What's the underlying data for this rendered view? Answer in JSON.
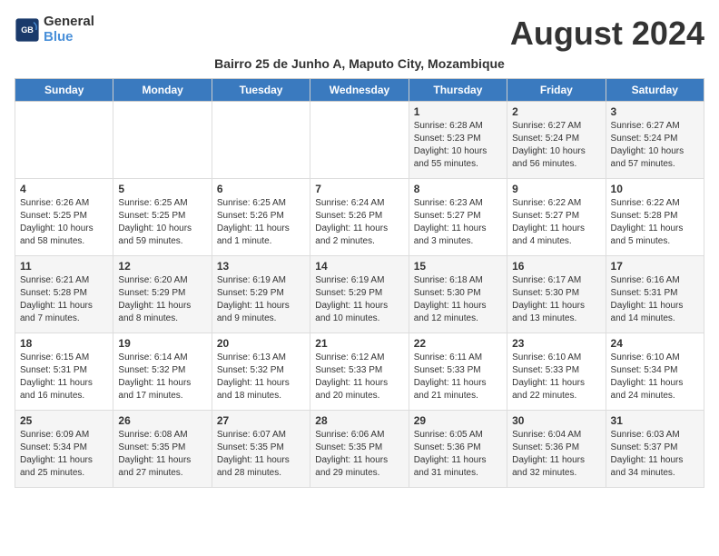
{
  "header": {
    "logo_general": "General",
    "logo_blue": "Blue",
    "month_title": "August 2024",
    "subtitle": "Bairro 25 de Junho A, Maputo City, Mozambique"
  },
  "days_of_week": [
    "Sunday",
    "Monday",
    "Tuesday",
    "Wednesday",
    "Thursday",
    "Friday",
    "Saturday"
  ],
  "weeks": [
    [
      {
        "day": "",
        "info": ""
      },
      {
        "day": "",
        "info": ""
      },
      {
        "day": "",
        "info": ""
      },
      {
        "day": "",
        "info": ""
      },
      {
        "day": "1",
        "info": "Sunrise: 6:28 AM\nSunset: 5:23 PM\nDaylight: 10 hours\nand 55 minutes."
      },
      {
        "day": "2",
        "info": "Sunrise: 6:27 AM\nSunset: 5:24 PM\nDaylight: 10 hours\nand 56 minutes."
      },
      {
        "day": "3",
        "info": "Sunrise: 6:27 AM\nSunset: 5:24 PM\nDaylight: 10 hours\nand 57 minutes."
      }
    ],
    [
      {
        "day": "4",
        "info": "Sunrise: 6:26 AM\nSunset: 5:25 PM\nDaylight: 10 hours\nand 58 minutes."
      },
      {
        "day": "5",
        "info": "Sunrise: 6:25 AM\nSunset: 5:25 PM\nDaylight: 10 hours\nand 59 minutes."
      },
      {
        "day": "6",
        "info": "Sunrise: 6:25 AM\nSunset: 5:26 PM\nDaylight: 11 hours\nand 1 minute."
      },
      {
        "day": "7",
        "info": "Sunrise: 6:24 AM\nSunset: 5:26 PM\nDaylight: 11 hours\nand 2 minutes."
      },
      {
        "day": "8",
        "info": "Sunrise: 6:23 AM\nSunset: 5:27 PM\nDaylight: 11 hours\nand 3 minutes."
      },
      {
        "day": "9",
        "info": "Sunrise: 6:22 AM\nSunset: 5:27 PM\nDaylight: 11 hours\nand 4 minutes."
      },
      {
        "day": "10",
        "info": "Sunrise: 6:22 AM\nSunset: 5:28 PM\nDaylight: 11 hours\nand 5 minutes."
      }
    ],
    [
      {
        "day": "11",
        "info": "Sunrise: 6:21 AM\nSunset: 5:28 PM\nDaylight: 11 hours\nand 7 minutes."
      },
      {
        "day": "12",
        "info": "Sunrise: 6:20 AM\nSunset: 5:29 PM\nDaylight: 11 hours\nand 8 minutes."
      },
      {
        "day": "13",
        "info": "Sunrise: 6:19 AM\nSunset: 5:29 PM\nDaylight: 11 hours\nand 9 minutes."
      },
      {
        "day": "14",
        "info": "Sunrise: 6:19 AM\nSunset: 5:29 PM\nDaylight: 11 hours\nand 10 minutes."
      },
      {
        "day": "15",
        "info": "Sunrise: 6:18 AM\nSunset: 5:30 PM\nDaylight: 11 hours\nand 12 minutes."
      },
      {
        "day": "16",
        "info": "Sunrise: 6:17 AM\nSunset: 5:30 PM\nDaylight: 11 hours\nand 13 minutes."
      },
      {
        "day": "17",
        "info": "Sunrise: 6:16 AM\nSunset: 5:31 PM\nDaylight: 11 hours\nand 14 minutes."
      }
    ],
    [
      {
        "day": "18",
        "info": "Sunrise: 6:15 AM\nSunset: 5:31 PM\nDaylight: 11 hours\nand 16 minutes."
      },
      {
        "day": "19",
        "info": "Sunrise: 6:14 AM\nSunset: 5:32 PM\nDaylight: 11 hours\nand 17 minutes."
      },
      {
        "day": "20",
        "info": "Sunrise: 6:13 AM\nSunset: 5:32 PM\nDaylight: 11 hours\nand 18 minutes."
      },
      {
        "day": "21",
        "info": "Sunrise: 6:12 AM\nSunset: 5:33 PM\nDaylight: 11 hours\nand 20 minutes."
      },
      {
        "day": "22",
        "info": "Sunrise: 6:11 AM\nSunset: 5:33 PM\nDaylight: 11 hours\nand 21 minutes."
      },
      {
        "day": "23",
        "info": "Sunrise: 6:10 AM\nSunset: 5:33 PM\nDaylight: 11 hours\nand 22 minutes."
      },
      {
        "day": "24",
        "info": "Sunrise: 6:10 AM\nSunset: 5:34 PM\nDaylight: 11 hours\nand 24 minutes."
      }
    ],
    [
      {
        "day": "25",
        "info": "Sunrise: 6:09 AM\nSunset: 5:34 PM\nDaylight: 11 hours\nand 25 minutes."
      },
      {
        "day": "26",
        "info": "Sunrise: 6:08 AM\nSunset: 5:35 PM\nDaylight: 11 hours\nand 27 minutes."
      },
      {
        "day": "27",
        "info": "Sunrise: 6:07 AM\nSunset: 5:35 PM\nDaylight: 11 hours\nand 28 minutes."
      },
      {
        "day": "28",
        "info": "Sunrise: 6:06 AM\nSunset: 5:35 PM\nDaylight: 11 hours\nand 29 minutes."
      },
      {
        "day": "29",
        "info": "Sunrise: 6:05 AM\nSunset: 5:36 PM\nDaylight: 11 hours\nand 31 minutes."
      },
      {
        "day": "30",
        "info": "Sunrise: 6:04 AM\nSunset: 5:36 PM\nDaylight: 11 hours\nand 32 minutes."
      },
      {
        "day": "31",
        "info": "Sunrise: 6:03 AM\nSunset: 5:37 PM\nDaylight: 11 hours\nand 34 minutes."
      }
    ]
  ]
}
